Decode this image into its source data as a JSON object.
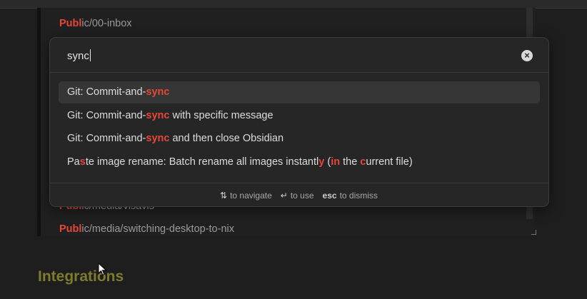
{
  "background": {
    "lines": [
      {
        "highlight": "Publ",
        "rest": "ic/00-inbox"
      },
      {
        "highlight": "Publ",
        "rest": "ic/media/visavis"
      },
      {
        "highlight": "Publ",
        "rest": "ic/media/switching-desktop-to-nix"
      }
    ],
    "heading": "Integrations"
  },
  "palette": {
    "search": {
      "value": "sync"
    },
    "results": [
      {
        "parts": [
          {
            "t": "Git: Commit-and-"
          },
          {
            "t": "sync",
            "m": true
          }
        ]
      },
      {
        "parts": [
          {
            "t": "Git: Commit-and-"
          },
          {
            "t": "sync",
            "m": true
          },
          {
            "t": " with specific message"
          }
        ]
      },
      {
        "parts": [
          {
            "t": "Git: Commit-and-"
          },
          {
            "t": "sync",
            "m": true
          },
          {
            "t": " and then close Obsidian"
          }
        ]
      },
      {
        "parts": [
          {
            "t": "Pa"
          },
          {
            "t": "s",
            "m": true
          },
          {
            "t": "te image rename: Batch rename all images instantl"
          },
          {
            "t": "y",
            "m": true
          },
          {
            "t": " ("
          },
          {
            "t": "in",
            "m": true
          },
          {
            "t": " the "
          },
          {
            "t": "c",
            "m": true
          },
          {
            "t": "urrent file)"
          }
        ]
      }
    ],
    "selected_index": 0,
    "footer": {
      "navigate_key": "⇅",
      "navigate_label": "to navigate",
      "use_key": "↵",
      "use_label": "to use",
      "dismiss_key": "esc",
      "dismiss_label": "to dismiss"
    }
  },
  "colors": {
    "match": "#e5473b",
    "heading": "#7e7a2e",
    "selected_bg": "#363636"
  },
  "icons": {
    "clear": "close-circle-icon",
    "cursor": "mouse-pointer-icon"
  }
}
